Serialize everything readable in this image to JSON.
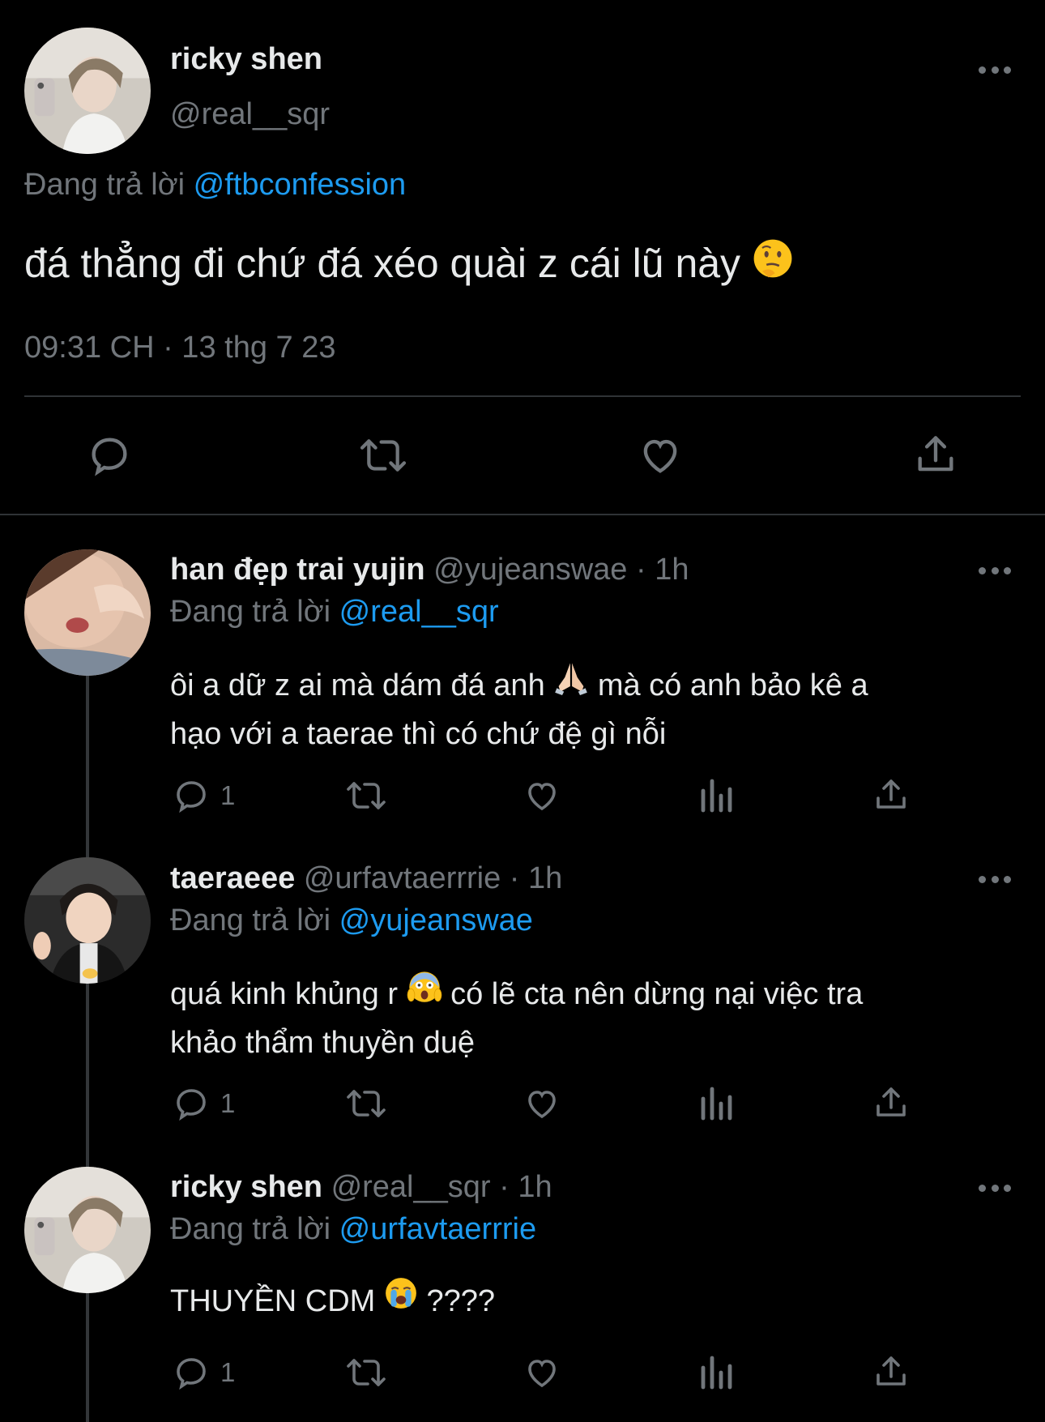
{
  "main_tweet": {
    "display_name": "ricky shen",
    "handle": "@real__sqr",
    "replying_prefix": "Đang trả lời",
    "replying_to": "@ftbconfession",
    "text": "đá thẳng đi chứ đá xéo quài z cái lũ này",
    "emoji": "thinking-face-emoji",
    "timestamp": "09:31 CH · 13 thg 7 23"
  },
  "replies": [
    {
      "display_name": "han đẹp trai yujin",
      "handle_time": "@yujeanswae · 1h",
      "replying_prefix": "Đang trả lời",
      "replying_to": "@real__sqr",
      "text_line1_a": "ôi a dữ z ai mà dám đá anh",
      "emoji": "folded-hands-emoji",
      "text_line1_b": "mà có anh bảo kê a",
      "text_line2": "hạo với a taerae thì có chứ đệ gì nỗi",
      "reply_count": "1"
    },
    {
      "display_name": "taeraeee",
      "handle_time": "@urfavtaerrrie · 1h",
      "replying_prefix": "Đang trả lời",
      "replying_to": "@yujeanswae",
      "text_line1_a": "quá kinh khủng r",
      "emoji": "screaming-face-emoji",
      "text_line1_b": "có lẽ cta nên dừng nại việc tra",
      "text_line2": "khảo thẩm thuyền duệ",
      "reply_count": "1"
    },
    {
      "display_name": "ricky shen",
      "handle_time": "@real__sqr · 1h",
      "replying_prefix": "Đang trả lời",
      "replying_to": "@urfavtaerrrie",
      "text_line1_a": "THUYỀN CDM",
      "emoji": "crying-face-emoji",
      "text_line1_b": "????",
      "reply_count": "1"
    }
  ],
  "colors": {
    "background": "#000000",
    "text": "#e7e9ea",
    "muted": "#71767b",
    "link": "#1d9bf0",
    "divider": "#2f3336"
  }
}
